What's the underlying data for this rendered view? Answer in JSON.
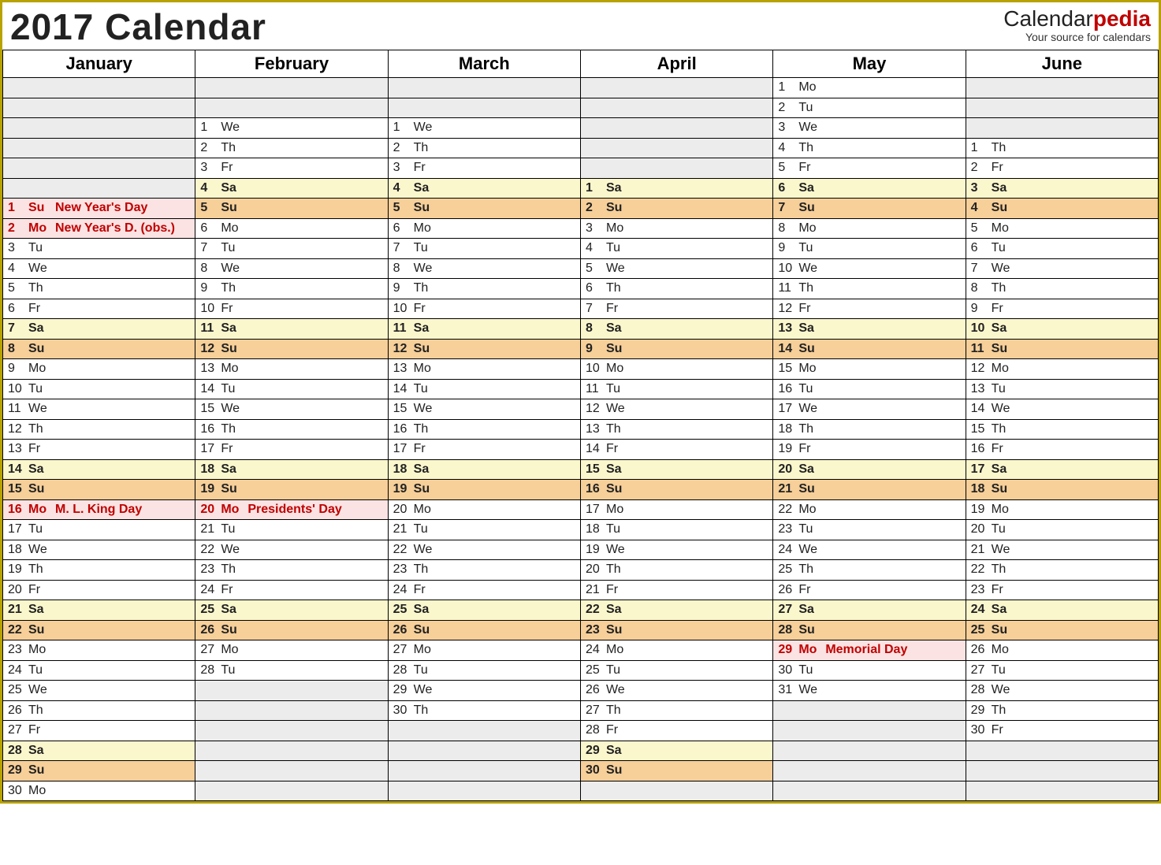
{
  "title": "2017 Calendar",
  "brand": {
    "a": "Calendar",
    "b": "pedia",
    "sub": "Your source for calendars"
  },
  "months": [
    "January",
    "February",
    "March",
    "April",
    "May",
    "June"
  ],
  "columns": [
    [
      null,
      null,
      null,
      null,
      null,
      null,
      {
        "n": 1,
        "d": "Su",
        "t": "sun hol",
        "e": "New Year's Day"
      },
      {
        "n": 2,
        "d": "Mo",
        "t": "hol",
        "e": "New Year's D. (obs.)"
      },
      {
        "n": 3,
        "d": "Tu"
      },
      {
        "n": 4,
        "d": "We"
      },
      {
        "n": 5,
        "d": "Th"
      },
      {
        "n": 6,
        "d": "Fr"
      },
      {
        "n": 7,
        "d": "Sa",
        "t": "sat"
      },
      {
        "n": 8,
        "d": "Su",
        "t": "sun"
      },
      {
        "n": 9,
        "d": "Mo"
      },
      {
        "n": 10,
        "d": "Tu"
      },
      {
        "n": 11,
        "d": "We"
      },
      {
        "n": 12,
        "d": "Th"
      },
      {
        "n": 13,
        "d": "Fr"
      },
      {
        "n": 14,
        "d": "Sa",
        "t": "sat"
      },
      {
        "n": 15,
        "d": "Su",
        "t": "sun"
      },
      {
        "n": 16,
        "d": "Mo",
        "t": "hol",
        "e": "M. L. King Day"
      },
      {
        "n": 17,
        "d": "Tu"
      },
      {
        "n": 18,
        "d": "We"
      },
      {
        "n": 19,
        "d": "Th"
      },
      {
        "n": 20,
        "d": "Fr"
      },
      {
        "n": 21,
        "d": "Sa",
        "t": "sat"
      },
      {
        "n": 22,
        "d": "Su",
        "t": "sun"
      },
      {
        "n": 23,
        "d": "Mo"
      },
      {
        "n": 24,
        "d": "Tu"
      },
      {
        "n": 25,
        "d": "We"
      },
      {
        "n": 26,
        "d": "Th"
      },
      {
        "n": 27,
        "d": "Fr"
      },
      {
        "n": 28,
        "d": "Sa",
        "t": "sat"
      },
      {
        "n": 29,
        "d": "Su",
        "t": "sun"
      },
      {
        "n": 30,
        "d": "Mo"
      }
    ],
    [
      null,
      null,
      {
        "n": 1,
        "d": "We"
      },
      {
        "n": 2,
        "d": "Th"
      },
      {
        "n": 3,
        "d": "Fr"
      },
      {
        "n": 4,
        "d": "Sa",
        "t": "sat"
      },
      {
        "n": 5,
        "d": "Su",
        "t": "sun"
      },
      {
        "n": 6,
        "d": "Mo"
      },
      {
        "n": 7,
        "d": "Tu"
      },
      {
        "n": 8,
        "d": "We"
      },
      {
        "n": 9,
        "d": "Th"
      },
      {
        "n": 10,
        "d": "Fr"
      },
      {
        "n": 11,
        "d": "Sa",
        "t": "sat"
      },
      {
        "n": 12,
        "d": "Su",
        "t": "sun"
      },
      {
        "n": 13,
        "d": "Mo"
      },
      {
        "n": 14,
        "d": "Tu"
      },
      {
        "n": 15,
        "d": "We"
      },
      {
        "n": 16,
        "d": "Th"
      },
      {
        "n": 17,
        "d": "Fr"
      },
      {
        "n": 18,
        "d": "Sa",
        "t": "sat"
      },
      {
        "n": 19,
        "d": "Su",
        "t": "sun"
      },
      {
        "n": 20,
        "d": "Mo",
        "t": "hol",
        "e": "Presidents' Day"
      },
      {
        "n": 21,
        "d": "Tu"
      },
      {
        "n": 22,
        "d": "We"
      },
      {
        "n": 23,
        "d": "Th"
      },
      {
        "n": 24,
        "d": "Fr"
      },
      {
        "n": 25,
        "d": "Sa",
        "t": "sat"
      },
      {
        "n": 26,
        "d": "Su",
        "t": "sun"
      },
      {
        "n": 27,
        "d": "Mo"
      },
      {
        "n": 28,
        "d": "Tu"
      },
      null,
      null,
      null,
      null,
      null,
      null
    ],
    [
      null,
      null,
      {
        "n": 1,
        "d": "We"
      },
      {
        "n": 2,
        "d": "Th"
      },
      {
        "n": 3,
        "d": "Fr"
      },
      {
        "n": 4,
        "d": "Sa",
        "t": "sat"
      },
      {
        "n": 5,
        "d": "Su",
        "t": "sun"
      },
      {
        "n": 6,
        "d": "Mo"
      },
      {
        "n": 7,
        "d": "Tu"
      },
      {
        "n": 8,
        "d": "We"
      },
      {
        "n": 9,
        "d": "Th"
      },
      {
        "n": 10,
        "d": "Fr"
      },
      {
        "n": 11,
        "d": "Sa",
        "t": "sat"
      },
      {
        "n": 12,
        "d": "Su",
        "t": "sun"
      },
      {
        "n": 13,
        "d": "Mo"
      },
      {
        "n": 14,
        "d": "Tu"
      },
      {
        "n": 15,
        "d": "We"
      },
      {
        "n": 16,
        "d": "Th"
      },
      {
        "n": 17,
        "d": "Fr"
      },
      {
        "n": 18,
        "d": "Sa",
        "t": "sat"
      },
      {
        "n": 19,
        "d": "Su",
        "t": "sun"
      },
      {
        "n": 20,
        "d": "Mo"
      },
      {
        "n": 21,
        "d": "Tu"
      },
      {
        "n": 22,
        "d": "We"
      },
      {
        "n": 23,
        "d": "Th"
      },
      {
        "n": 24,
        "d": "Fr"
      },
      {
        "n": 25,
        "d": "Sa",
        "t": "sat"
      },
      {
        "n": 26,
        "d": "Su",
        "t": "sun"
      },
      {
        "n": 27,
        "d": "Mo"
      },
      {
        "n": 28,
        "d": "Tu"
      },
      {
        "n": 29,
        "d": "We"
      },
      {
        "n": 30,
        "d": "Th"
      },
      null,
      null,
      null,
      null
    ],
    [
      null,
      null,
      null,
      null,
      null,
      {
        "n": 1,
        "d": "Sa",
        "t": "sat"
      },
      {
        "n": 2,
        "d": "Su",
        "t": "sun"
      },
      {
        "n": 3,
        "d": "Mo"
      },
      {
        "n": 4,
        "d": "Tu"
      },
      {
        "n": 5,
        "d": "We"
      },
      {
        "n": 6,
        "d": "Th"
      },
      {
        "n": 7,
        "d": "Fr"
      },
      {
        "n": 8,
        "d": "Sa",
        "t": "sat"
      },
      {
        "n": 9,
        "d": "Su",
        "t": "sun"
      },
      {
        "n": 10,
        "d": "Mo"
      },
      {
        "n": 11,
        "d": "Tu"
      },
      {
        "n": 12,
        "d": "We"
      },
      {
        "n": 13,
        "d": "Th"
      },
      {
        "n": 14,
        "d": "Fr"
      },
      {
        "n": 15,
        "d": "Sa",
        "t": "sat"
      },
      {
        "n": 16,
        "d": "Su",
        "t": "sun"
      },
      {
        "n": 17,
        "d": "Mo"
      },
      {
        "n": 18,
        "d": "Tu"
      },
      {
        "n": 19,
        "d": "We"
      },
      {
        "n": 20,
        "d": "Th"
      },
      {
        "n": 21,
        "d": "Fr"
      },
      {
        "n": 22,
        "d": "Sa",
        "t": "sat"
      },
      {
        "n": 23,
        "d": "Su",
        "t": "sun"
      },
      {
        "n": 24,
        "d": "Mo"
      },
      {
        "n": 25,
        "d": "Tu"
      },
      {
        "n": 26,
        "d": "We"
      },
      {
        "n": 27,
        "d": "Th"
      },
      {
        "n": 28,
        "d": "Fr"
      },
      {
        "n": 29,
        "d": "Sa",
        "t": "sat"
      },
      {
        "n": 30,
        "d": "Su",
        "t": "sun"
      },
      null
    ],
    [
      {
        "n": 1,
        "d": "Mo"
      },
      {
        "n": 2,
        "d": "Tu"
      },
      {
        "n": 3,
        "d": "We"
      },
      {
        "n": 4,
        "d": "Th"
      },
      {
        "n": 5,
        "d": "Fr"
      },
      {
        "n": 6,
        "d": "Sa",
        "t": "sat"
      },
      {
        "n": 7,
        "d": "Su",
        "t": "sun"
      },
      {
        "n": 8,
        "d": "Mo"
      },
      {
        "n": 9,
        "d": "Tu"
      },
      {
        "n": 10,
        "d": "We"
      },
      {
        "n": 11,
        "d": "Th"
      },
      {
        "n": 12,
        "d": "Fr"
      },
      {
        "n": 13,
        "d": "Sa",
        "t": "sat"
      },
      {
        "n": 14,
        "d": "Su",
        "t": "sun"
      },
      {
        "n": 15,
        "d": "Mo"
      },
      {
        "n": 16,
        "d": "Tu"
      },
      {
        "n": 17,
        "d": "We"
      },
      {
        "n": 18,
        "d": "Th"
      },
      {
        "n": 19,
        "d": "Fr"
      },
      {
        "n": 20,
        "d": "Sa",
        "t": "sat"
      },
      {
        "n": 21,
        "d": "Su",
        "t": "sun"
      },
      {
        "n": 22,
        "d": "Mo"
      },
      {
        "n": 23,
        "d": "Tu"
      },
      {
        "n": 24,
        "d": "We"
      },
      {
        "n": 25,
        "d": "Th"
      },
      {
        "n": 26,
        "d": "Fr"
      },
      {
        "n": 27,
        "d": "Sa",
        "t": "sat"
      },
      {
        "n": 28,
        "d": "Su",
        "t": "sun"
      },
      {
        "n": 29,
        "d": "Mo",
        "t": "hol",
        "e": "Memorial Day"
      },
      {
        "n": 30,
        "d": "Tu"
      },
      {
        "n": 31,
        "d": "We"
      },
      null,
      null,
      null,
      null,
      null
    ],
    [
      null,
      null,
      null,
      {
        "n": 1,
        "d": "Th"
      },
      {
        "n": 2,
        "d": "Fr"
      },
      {
        "n": 3,
        "d": "Sa",
        "t": "sat"
      },
      {
        "n": 4,
        "d": "Su",
        "t": "sun"
      },
      {
        "n": 5,
        "d": "Mo"
      },
      {
        "n": 6,
        "d": "Tu"
      },
      {
        "n": 7,
        "d": "We"
      },
      {
        "n": 8,
        "d": "Th"
      },
      {
        "n": 9,
        "d": "Fr"
      },
      {
        "n": 10,
        "d": "Sa",
        "t": "sat"
      },
      {
        "n": 11,
        "d": "Su",
        "t": "sun"
      },
      {
        "n": 12,
        "d": "Mo"
      },
      {
        "n": 13,
        "d": "Tu"
      },
      {
        "n": 14,
        "d": "We"
      },
      {
        "n": 15,
        "d": "Th"
      },
      {
        "n": 16,
        "d": "Fr"
      },
      {
        "n": 17,
        "d": "Sa",
        "t": "sat"
      },
      {
        "n": 18,
        "d": "Su",
        "t": "sun"
      },
      {
        "n": 19,
        "d": "Mo"
      },
      {
        "n": 20,
        "d": "Tu"
      },
      {
        "n": 21,
        "d": "We"
      },
      {
        "n": 22,
        "d": "Th"
      },
      {
        "n": 23,
        "d": "Fr"
      },
      {
        "n": 24,
        "d": "Sa",
        "t": "sat"
      },
      {
        "n": 25,
        "d": "Su",
        "t": "sun"
      },
      {
        "n": 26,
        "d": "Mo"
      },
      {
        "n": 27,
        "d": "Tu"
      },
      {
        "n": 28,
        "d": "We"
      },
      {
        "n": 29,
        "d": "Th"
      },
      {
        "n": 30,
        "d": "Fr"
      },
      null,
      null,
      null
    ]
  ],
  "rows": 36
}
